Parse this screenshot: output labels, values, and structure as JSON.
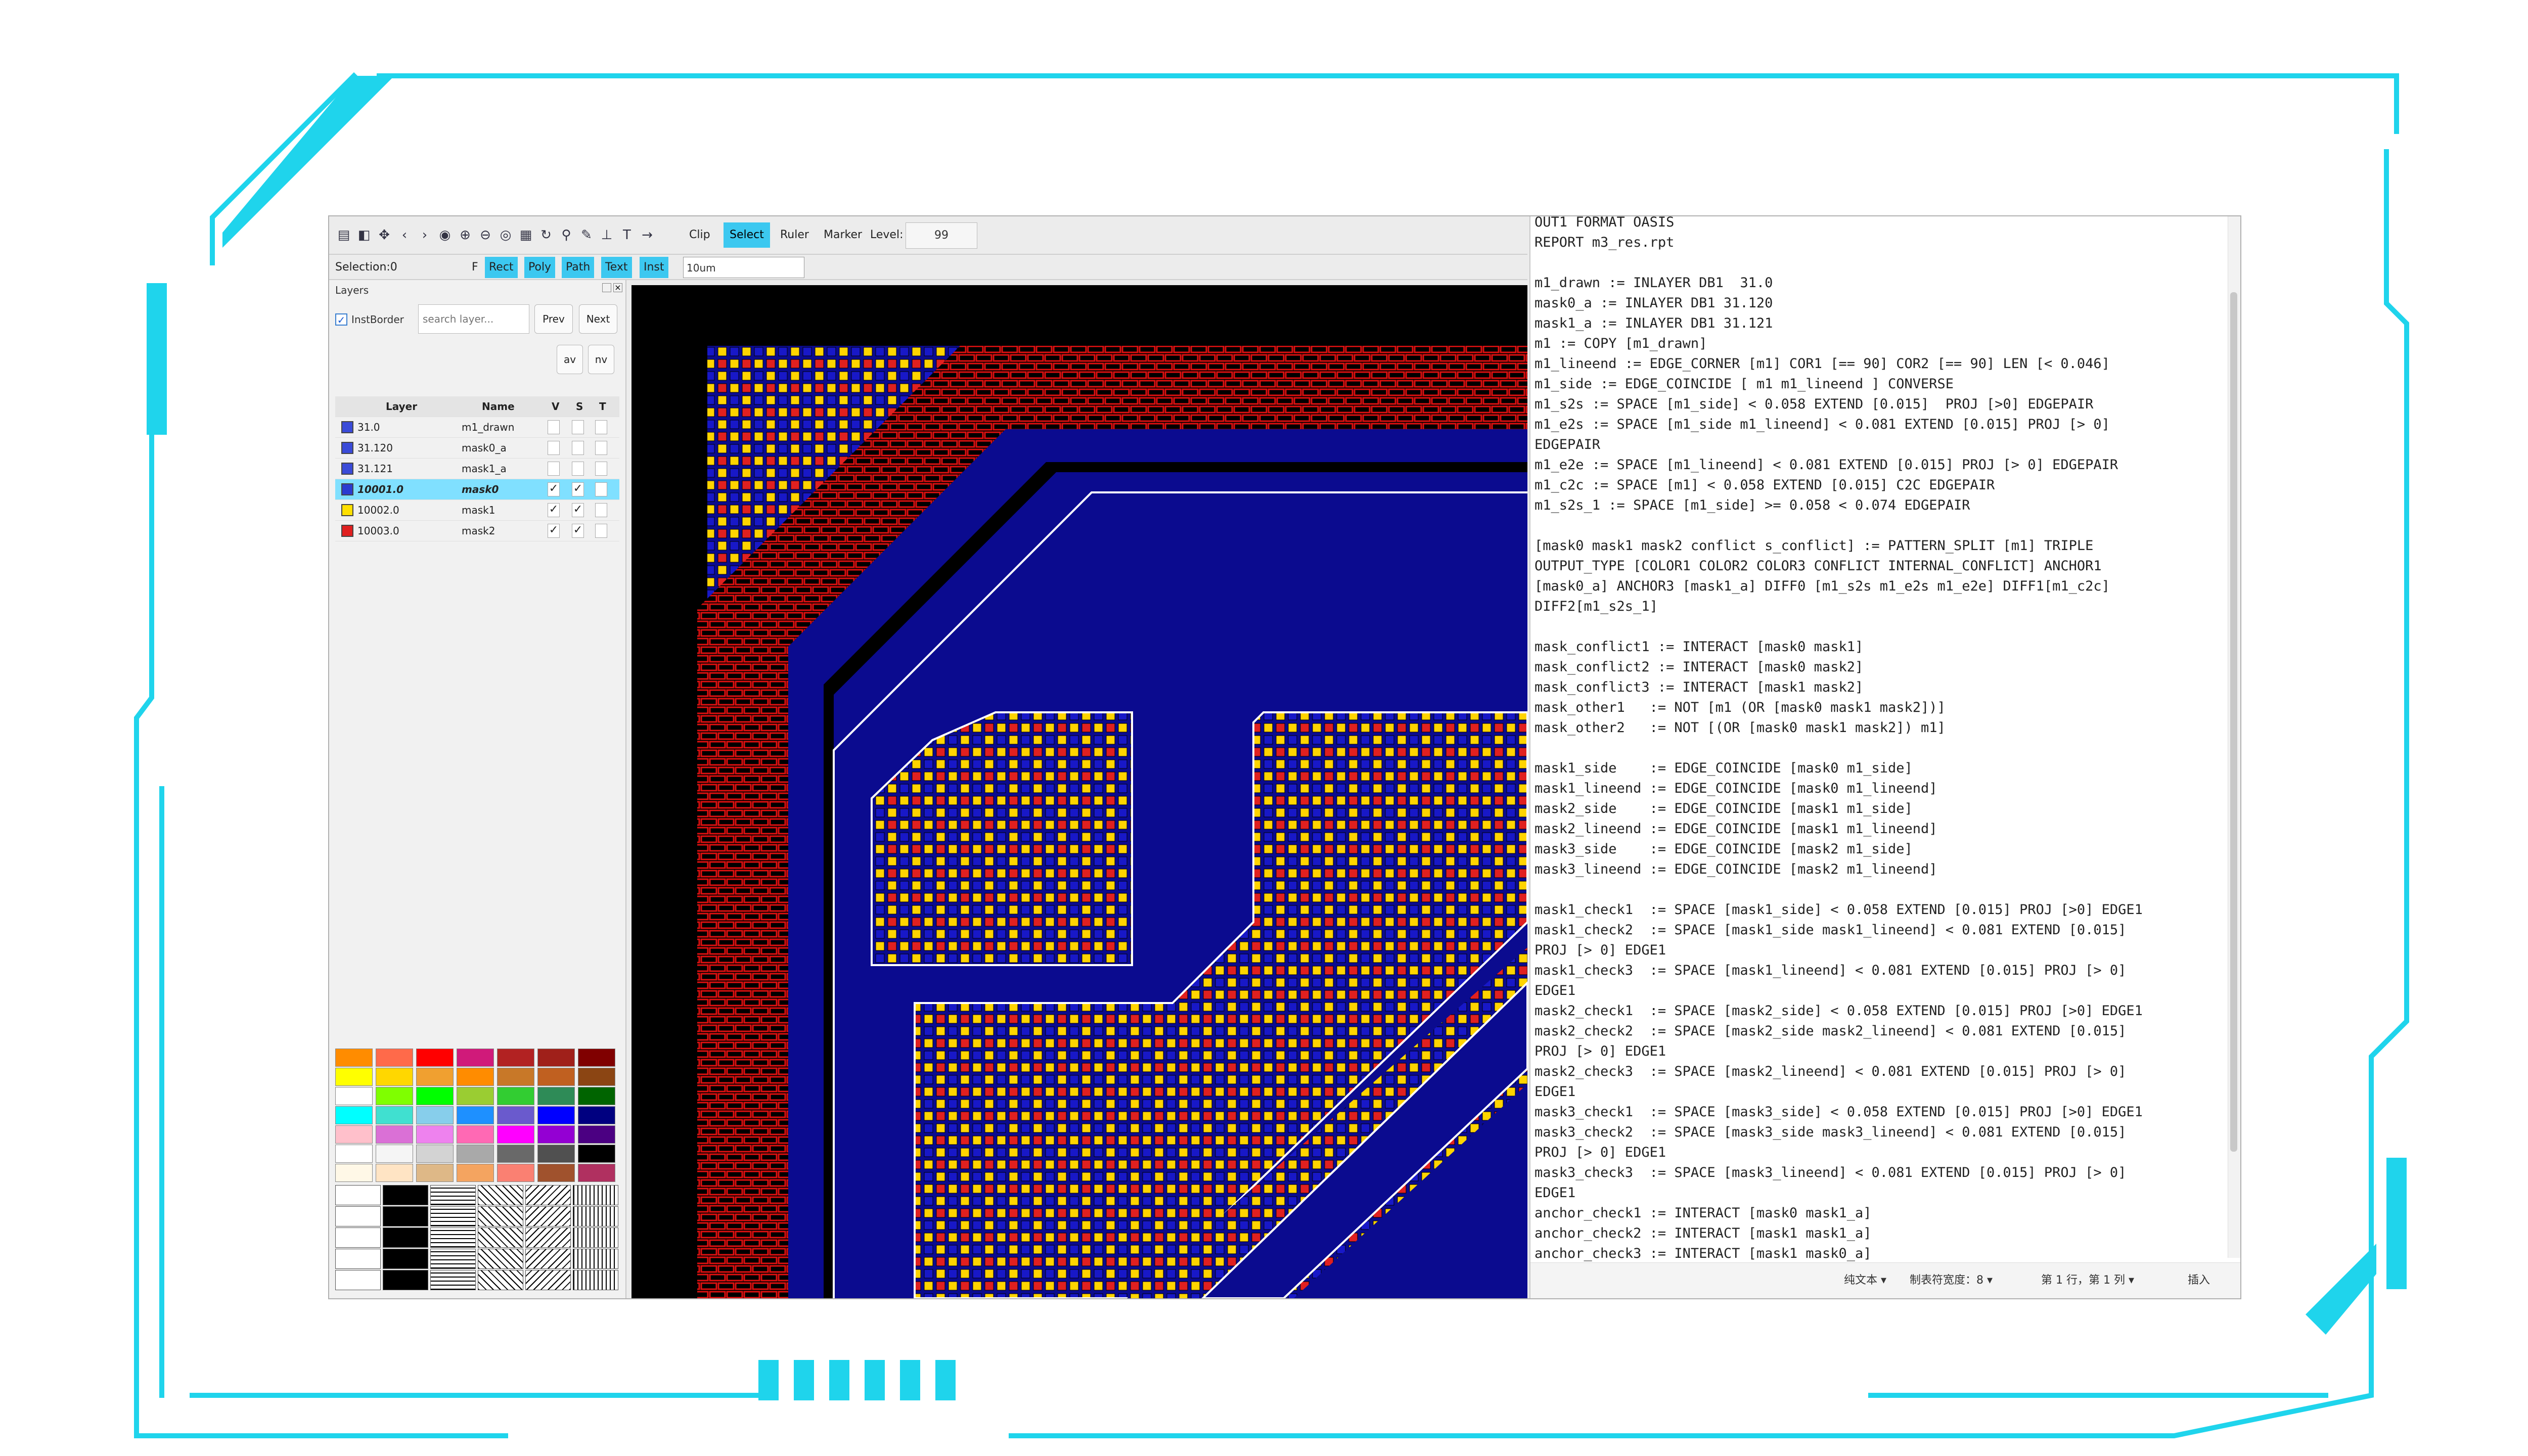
{
  "colors": {
    "frame": "#1fd4ec",
    "accent": "#3cc8f0",
    "canvas_bg": "#000000",
    "blue": "#0b0b8f",
    "red": "#e01010",
    "yellow": "#ffd400",
    "select": "#80e0ff"
  },
  "toolbar": {
    "icons": [
      "save-icon",
      "open-icon",
      "move-icon",
      "back-icon",
      "forward-icon",
      "target-icon",
      "zoom-in-icon",
      "zoom-out-icon",
      "eye-icon",
      "grid-icon",
      "refresh-icon",
      "search-icon",
      "pencil-icon",
      "align-bottom-icon",
      "text-tool-icon",
      "arrow-right-icon"
    ],
    "clip": "Clip",
    "select": "Select",
    "ruler": "Ruler",
    "marker": "Marker",
    "level_label": "Level:",
    "level_value": "99"
  },
  "subbar": {
    "selection": "Selection:0",
    "f": "F",
    "rect": "Rect",
    "poly": "Poly",
    "path": "Path",
    "text": "Text",
    "inst": "Inst",
    "scale": "10um"
  },
  "layers": {
    "title": "Layers",
    "instborder": "InstBorder",
    "search_placeholder": "search layer...",
    "prev": "Prev",
    "next": "Next",
    "av": "av",
    "nv": "nv",
    "headers": {
      "layer": "Layer",
      "name": "Name",
      "v": "V",
      "s": "S",
      "t": "T"
    },
    "rows": [
      {
        "layer": "31.0",
        "name": "m1_drawn",
        "color": "#3a4bd8",
        "v": "",
        "s": "",
        "t": ""
      },
      {
        "layer": "31.120",
        "name": "mask0_a",
        "color": "#3a4bd8",
        "v": "",
        "s": "",
        "t": ""
      },
      {
        "layer": "31.121",
        "name": "mask1_a",
        "color": "#3a4bd8",
        "v": "",
        "s": "",
        "t": ""
      },
      {
        "layer": "10001.0",
        "name": "mask0",
        "color": "#2a3bd0",
        "v": "✓",
        "s": "✓",
        "t": ""
      },
      {
        "layer": "10002.0",
        "name": "mask1",
        "color": "#ffe000",
        "v": "✓",
        "s": "✓",
        "t": ""
      },
      {
        "layer": "10003.0",
        "name": "mask2",
        "color": "#e02020",
        "v": "✓",
        "s": "✓",
        "t": ""
      }
    ],
    "selected_row": 3,
    "palette": [
      [
        "#ff8c00",
        "#ff6a4a",
        "#ff0000",
        "#d01a7a",
        "#b22222",
        "#a0201a",
        "#800000"
      ],
      [
        "#ffff00",
        "#ffd700",
        "#f0a030",
        "#ff8c00",
        "#c87828",
        "#c06020",
        "#8b4513"
      ],
      [
        "#ffffff",
        "#7fff00",
        "#00ff00",
        "#9acd32",
        "#32cd32",
        "#2e8b57",
        "#006400"
      ],
      [
        "#00ffff",
        "#40e0d0",
        "#87ceeb",
        "#1e90ff",
        "#6a5acd",
        "#0000ff",
        "#000080"
      ],
      [
        "#ffc0cb",
        "#da70d6",
        "#ee82ee",
        "#ff69b4",
        "#ff00ff",
        "#9400d3",
        "#4b0082"
      ],
      [
        "#ffffff",
        "#f5f5f5",
        "#d3d3d3",
        "#a9a9a9",
        "#696969",
        "#505050",
        "#000000"
      ],
      [
        "#fff8e7",
        "#ffe4c4",
        "#deb887",
        "#f4a460",
        "#fa8072",
        "#a0522d",
        "#b03060"
      ]
    ]
  },
  "editor": {
    "lines": [
      "OUT1 FORMAT OASIS",
      "REPORT m3_res.rpt",
      "",
      "m1_drawn := INLAYER DB1  31.0",
      "mask0_a := INLAYER DB1 31.120",
      "mask1_a := INLAYER DB1 31.121",
      "m1 := COPY [m1_drawn]",
      "m1_lineend := EDGE_CORNER [m1] COR1 [== 90] COR2 [== 90] LEN [< 0.046]",
      "m1_side := EDGE_COINCIDE [ m1 m1_lineend ] CONVERSE",
      "m1_s2s := SPACE [m1_side] < 0.058 EXTEND [0.015]  PROJ [>0] EDGEPAIR",
      "m1_e2s := SPACE [m1_side m1_lineend] < 0.081 EXTEND [0.015] PROJ [> 0]",
      "EDGEPAIR",
      "m1_e2e := SPACE [m1_lineend] < 0.081 EXTEND [0.015] PROJ [> 0] EDGEPAIR",
      "m1_c2c := SPACE [m1] < 0.058 EXTEND [0.015] C2C EDGEPAIR",
      "m1_s2s_1 := SPACE [m1_side] >= 0.058 < 0.074 EDGEPAIR",
      "",
      "[mask0 mask1 mask2 conflict s_conflict] := PATTERN_SPLIT [m1] TRIPLE",
      "OUTPUT_TYPE [COLOR1 COLOR2 COLOR3 CONFLICT INTERNAL_CONFLICT] ANCHOR1",
      "[mask0_a] ANCHOR3 [mask1_a] DIFF0 [m1_s2s m1_e2s m1_e2e] DIFF1[m1_c2c]",
      "DIFF2[m1_s2s_1]",
      "",
      "mask_conflict1 := INTERACT [mask0 mask1]",
      "mask_conflict2 := INTERACT [mask0 mask2]",
      "mask_conflict3 := INTERACT [mask1 mask2]",
      "mask_other1   := NOT [m1 (OR [mask0 mask1 mask2])]",
      "mask_other2   := NOT [(OR [mask0 mask1 mask2]) m1]",
      "",
      "mask1_side    := EDGE_COINCIDE [mask0 m1_side]",
      "mask1_lineend := EDGE_COINCIDE [mask0 m1_lineend]",
      "mask2_side    := EDGE_COINCIDE [mask1 m1_side]",
      "mask2_lineend := EDGE_COINCIDE [mask1 m1_lineend]",
      "mask3_side    := EDGE_COINCIDE [mask2 m1_side]",
      "mask3_lineend := EDGE_COINCIDE [mask2 m1_lineend]",
      "",
      "mask1_check1  := SPACE [mask1_side] < 0.058 EXTEND [0.015] PROJ [>0] EDGE1",
      "mask1_check2  := SPACE [mask1_side mask1_lineend] < 0.081 EXTEND [0.015]",
      "PROJ [> 0] EDGE1",
      "mask1_check3  := SPACE [mask1_lineend] < 0.081 EXTEND [0.015] PROJ [> 0]",
      "EDGE1",
      "mask2_check1  := SPACE [mask2_side] < 0.058 EXTEND [0.015] PROJ [>0] EDGE1",
      "mask2_check2  := SPACE [mask2_side mask2_lineend] < 0.081 EXTEND [0.015]",
      "PROJ [> 0] EDGE1",
      "mask2_check3  := SPACE [mask2_lineend] < 0.081 EXTEND [0.015] PROJ [> 0]",
      "EDGE1",
      "mask3_check1  := SPACE [mask3_side] < 0.058 EXTEND [0.015] PROJ [>0] EDGE1",
      "mask3_check2  := SPACE [mask3_side mask3_lineend] < 0.081 EXTEND [0.015]",
      "PROJ [> 0] EDGE1",
      "mask3_check3  := SPACE [mask3_lineend] < 0.081 EXTEND [0.015] PROJ [> 0]",
      "EDGE1",
      "anchor_check1 := INTERACT [mask0 mask1_a]",
      "anchor_check2 := INTERACT [mask1 mask1_a]",
      "anchor_check3 := INTERACT [mask1 mask0_a]"
    ],
    "status": {
      "format": "纯文本 ▾",
      "tab": "制表符宽度：8 ▾",
      "pos": "第 1 行，第 1 列 ▾",
      "mode": "插入"
    }
  }
}
